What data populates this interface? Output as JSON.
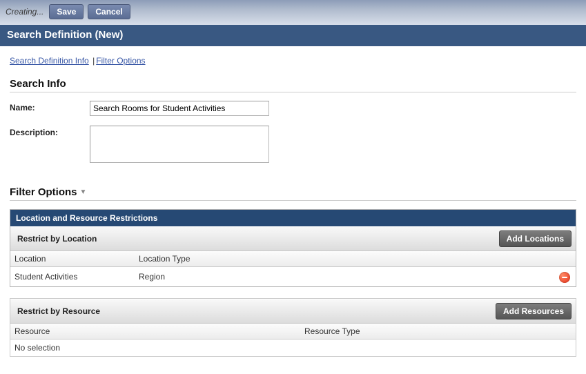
{
  "topbar": {
    "status": "Creating...",
    "save": "Save",
    "cancel": "Cancel"
  },
  "title": "Search Definition (New)",
  "nav": {
    "info": "Search Definition Info",
    "filter": "Filter Options"
  },
  "search_info": {
    "heading": "Search Info",
    "name_label": "Name:",
    "name_value": "Search Rooms for Student Activities",
    "desc_label": "Description:",
    "desc_value": ""
  },
  "filter": {
    "heading": "Filter Options",
    "panel_title": "Location and Resource Restrictions",
    "loc": {
      "title": "Restrict by Location",
      "add": "Add Locations",
      "cols": {
        "c1": "Location",
        "c2": "Location Type"
      },
      "rows": [
        {
          "c1": "Student Activities",
          "c2": "Region"
        }
      ]
    },
    "res": {
      "title": "Restrict by Resource",
      "add": "Add Resources",
      "cols": {
        "c1": "Resource",
        "c2": "Resource Type"
      },
      "empty": "No selection"
    }
  }
}
